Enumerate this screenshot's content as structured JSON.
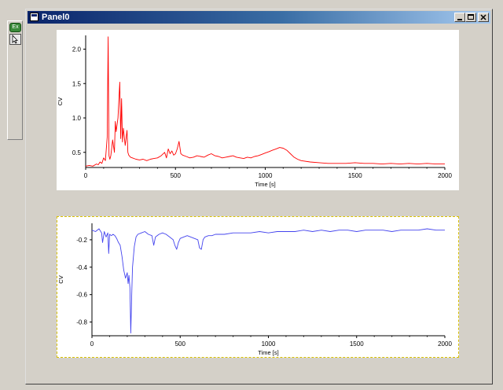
{
  "palette": {
    "mode_button_label": "Ex",
    "tool_icon": "arrow-pointer-icon"
  },
  "window": {
    "title": "Panel0",
    "controls": {
      "minimize_icon": "minimize-icon",
      "maximize_icon": "maximize-icon",
      "close_icon": "close-icon"
    }
  },
  "chart_data": [
    {
      "type": "line",
      "xlabel": "Time [s]",
      "ylabel": "CV",
      "xlim": [
        0,
        2000
      ],
      "ylim": [
        0.28,
        2.2
      ],
      "x_ticks": [
        0,
        500,
        1000,
        1500,
        2000
      ],
      "y_ticks": [
        0.5,
        1.0,
        1.5,
        2.0
      ],
      "y_tick_labels": [
        "0.5",
        "1.0",
        "1.5",
        "2.0"
      ],
      "series": [
        {
          "color": "#ff0000",
          "x": [
            0,
            20,
            40,
            60,
            70,
            80,
            90,
            100,
            110,
            120,
            125,
            130,
            135,
            140,
            150,
            160,
            165,
            170,
            180,
            190,
            195,
            200,
            205,
            210,
            220,
            230,
            235,
            240,
            250,
            260,
            280,
            300,
            320,
            340,
            360,
            380,
            400,
            420,
            440,
            450,
            460,
            470,
            480,
            490,
            500,
            510,
            520,
            530,
            540,
            560,
            580,
            600,
            620,
            640,
            660,
            680,
            700,
            720,
            740,
            760,
            780,
            800,
            820,
            840,
            860,
            880,
            900,
            920,
            940,
            960,
            980,
            1000,
            1020,
            1040,
            1060,
            1080,
            1100,
            1120,
            1140,
            1160,
            1180,
            1200,
            1250,
            1300,
            1350,
            1400,
            1450,
            1500,
            1550,
            1600,
            1650,
            1700,
            1750,
            1800,
            1850,
            1900,
            1950,
            2000
          ],
          "y": [
            0.3,
            0.31,
            0.3,
            0.33,
            0.32,
            0.36,
            0.34,
            0.42,
            0.38,
            0.72,
            2.18,
            0.45,
            0.4,
            0.45,
            0.68,
            0.5,
            0.95,
            0.8,
            1.0,
            1.52,
            0.7,
            1.28,
            0.65,
            0.85,
            0.6,
            0.82,
            0.5,
            0.46,
            0.43,
            0.42,
            0.4,
            0.39,
            0.4,
            0.38,
            0.4,
            0.41,
            0.42,
            0.45,
            0.5,
            0.42,
            0.55,
            0.48,
            0.52,
            0.46,
            0.48,
            0.55,
            0.66,
            0.48,
            0.46,
            0.44,
            0.42,
            0.43,
            0.45,
            0.44,
            0.43,
            0.46,
            0.48,
            0.45,
            0.44,
            0.42,
            0.43,
            0.44,
            0.45,
            0.43,
            0.42,
            0.41,
            0.43,
            0.42,
            0.44,
            0.45,
            0.47,
            0.49,
            0.51,
            0.53,
            0.55,
            0.57,
            0.56,
            0.53,
            0.48,
            0.43,
            0.4,
            0.38,
            0.36,
            0.35,
            0.34,
            0.34,
            0.34,
            0.35,
            0.34,
            0.34,
            0.33,
            0.34,
            0.33,
            0.34,
            0.33,
            0.34,
            0.33,
            0.33
          ]
        }
      ]
    },
    {
      "type": "line",
      "xlabel": "Time [s]",
      "ylabel": "CV",
      "xlim": [
        0,
        2000
      ],
      "ylim": [
        -0.9,
        -0.08
      ],
      "x_ticks": [
        0,
        500,
        1000,
        1500,
        2000
      ],
      "y_ticks": [
        -0.2,
        -0.4,
        -0.6,
        -0.8
      ],
      "y_tick_labels": [
        "-0.2",
        "-0.4",
        "-0.6",
        "-0.8"
      ],
      "series": [
        {
          "color": "#4444ee",
          "x": [
            0,
            20,
            40,
            55,
            60,
            70,
            80,
            90,
            95,
            100,
            110,
            120,
            130,
            140,
            150,
            160,
            170,
            180,
            190,
            200,
            205,
            210,
            215,
            220,
            225,
            230,
            240,
            250,
            260,
            280,
            300,
            320,
            340,
            350,
            360,
            380,
            400,
            420,
            440,
            460,
            470,
            480,
            490,
            500,
            520,
            540,
            560,
            580,
            600,
            610,
            620,
            630,
            640,
            660,
            680,
            700,
            750,
            800,
            850,
            900,
            950,
            1000,
            1050,
            1100,
            1150,
            1200,
            1250,
            1300,
            1350,
            1400,
            1450,
            1500,
            1550,
            1600,
            1650,
            1700,
            1750,
            1800,
            1850,
            1900,
            1950,
            2000
          ],
          "y": [
            -0.13,
            -0.14,
            -0.12,
            -0.15,
            -0.22,
            -0.14,
            -0.18,
            -0.15,
            -0.3,
            -0.16,
            -0.17,
            -0.16,
            -0.17,
            -0.19,
            -0.22,
            -0.24,
            -0.32,
            -0.42,
            -0.48,
            -0.44,
            -0.52,
            -0.46,
            -0.55,
            -0.88,
            -0.62,
            -0.4,
            -0.25,
            -0.18,
            -0.16,
            -0.15,
            -0.14,
            -0.16,
            -0.17,
            -0.24,
            -0.18,
            -0.16,
            -0.15,
            -0.16,
            -0.18,
            -0.2,
            -0.24,
            -0.27,
            -0.22,
            -0.19,
            -0.18,
            -0.17,
            -0.18,
            -0.19,
            -0.2,
            -0.26,
            -0.27,
            -0.2,
            -0.18,
            -0.17,
            -0.17,
            -0.16,
            -0.16,
            -0.15,
            -0.15,
            -0.15,
            -0.14,
            -0.15,
            -0.14,
            -0.14,
            -0.14,
            -0.13,
            -0.14,
            -0.13,
            -0.14,
            -0.13,
            -0.13,
            -0.14,
            -0.13,
            -0.13,
            -0.13,
            -0.14,
            -0.13,
            -0.13,
            -0.13,
            -0.12,
            -0.13,
            -0.13
          ]
        }
      ]
    }
  ]
}
